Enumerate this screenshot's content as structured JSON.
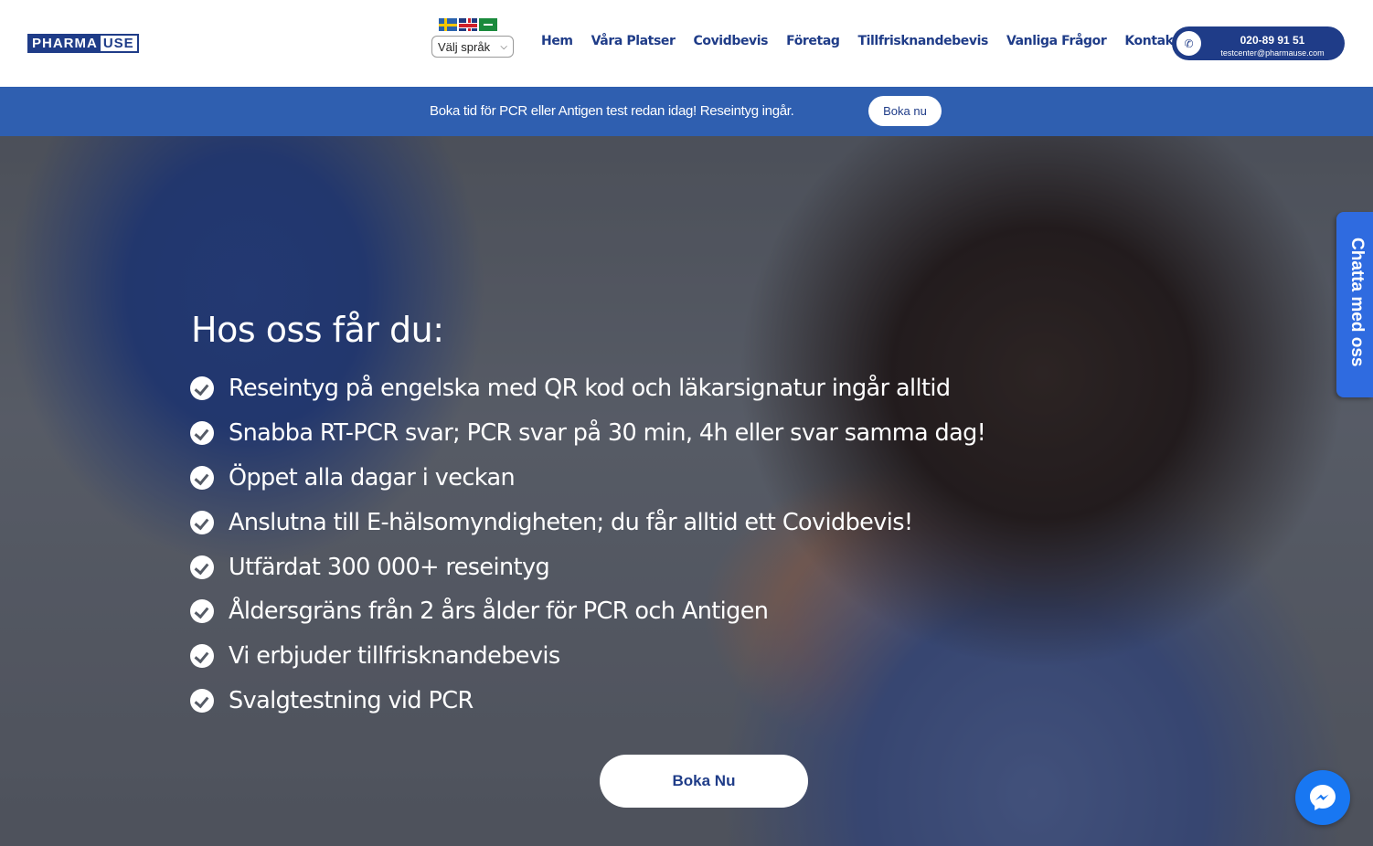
{
  "header": {
    "logo": {
      "part1": "PHARMA",
      "part2": "USE"
    },
    "language": {
      "flags": [
        "swedish-flag-icon",
        "british-flag-icon",
        "saudi-flag-icon"
      ],
      "select_value": "Välj språk"
    },
    "nav": [
      "Hem",
      "Våra Platser",
      "Covidbevis",
      "Företag",
      "Tillfrisknandebevis",
      "Vanliga Frågor",
      "Kontakta Oss"
    ],
    "contact": {
      "phone": "020-89 91 51",
      "email": "testcenter@pharmause.com"
    }
  },
  "banner": {
    "text": "Boka tid för PCR eller Antigen test redan idag! Reseintyg ingår.",
    "button": "Boka nu"
  },
  "hero": {
    "heading": "Hos oss får du:",
    "items": [
      "Reseintyg på engelska med QR kod och läkarsignatur ingår alltid",
      "Snabba RT-PCR svar; PCR svar på 30 min, 4h eller svar samma dag!",
      "Öppet alla dagar i veckan",
      "Anslutna till E-hälsomyndigheten; du får alltid ett Covidbevis!",
      "Utfärdat 300 000+ reseintyg",
      "Åldersgräns från 2 års ålder för PCR och Antigen",
      "Vi erbjuder tillfrisknandebevis",
      "Svalgtestning vid PCR"
    ],
    "cta": "Boka Nu"
  },
  "chat_tab": "Chatta med oss",
  "colors": {
    "brand": "#1f3c88",
    "banner": "#2f5fb0",
    "chat": "#2f6be0",
    "messenger": "#1877f2"
  }
}
